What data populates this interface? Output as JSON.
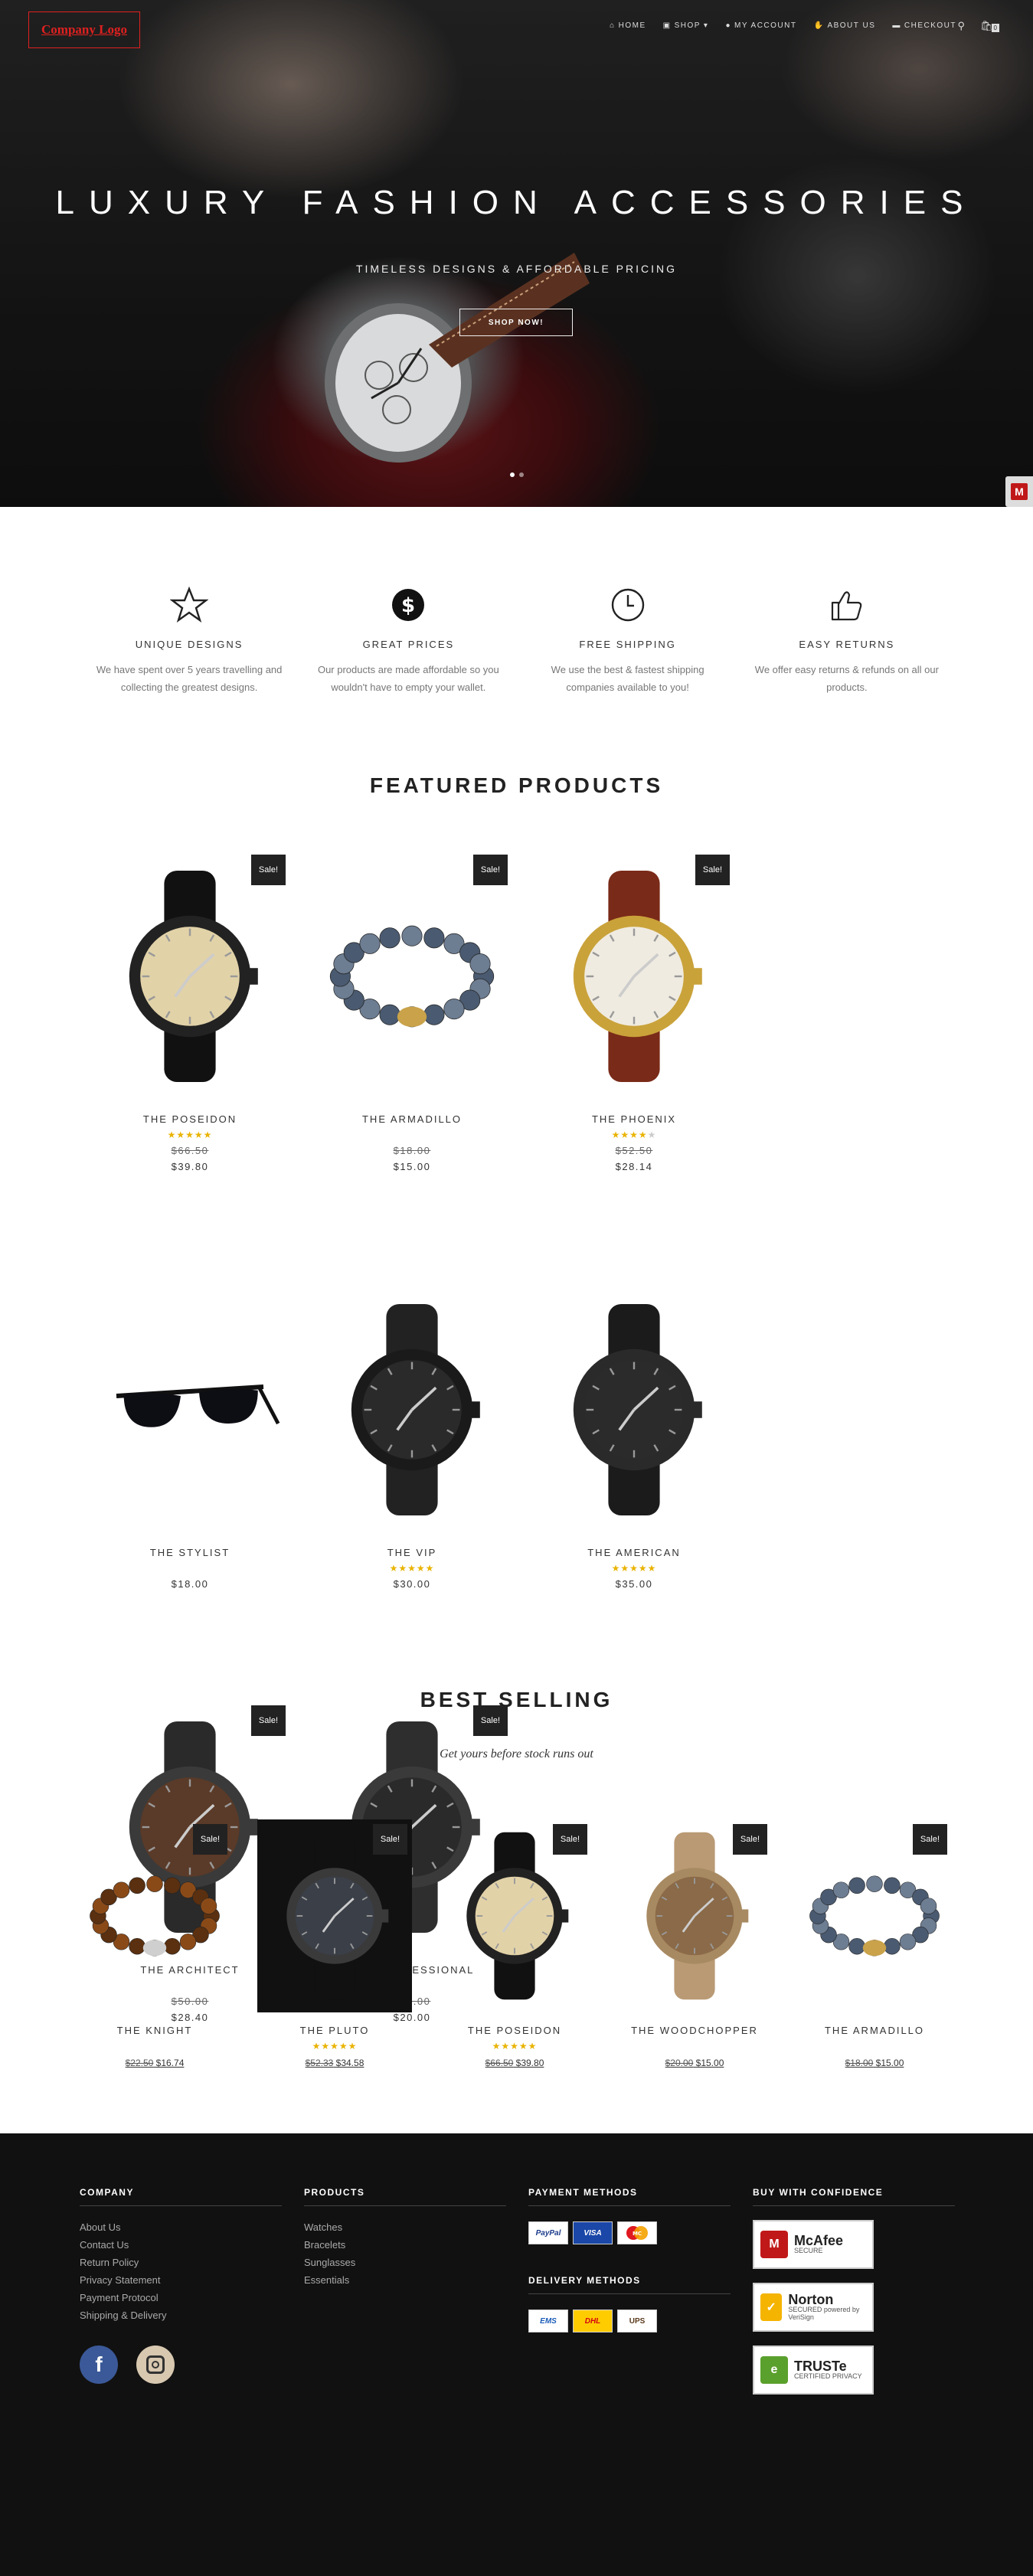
{
  "header": {
    "logo_text": "Company Logo",
    "nav": [
      {
        "label": "HOME",
        "icon": "home-icon"
      },
      {
        "label": "SHOP",
        "icon": "bag-icon"
      },
      {
        "label": "MY ACCOUNT",
        "icon": "user-icon"
      },
      {
        "label": "ABOUT US",
        "icon": "thumb-icon"
      },
      {
        "label": "CHECKOUT",
        "icon": "truck-icon"
      }
    ],
    "cart_count": "0"
  },
  "hero": {
    "title": "LUXURY FASHION ACCESSORIES",
    "subtitle": "TIMELESS DESIGNS & AFFORDABLE PRICING",
    "button": "SHOP NOW!"
  },
  "features": [
    {
      "title": "UNIQUE DESIGNS",
      "text": "We have spent over 5 years travelling and collecting the greatest designs.",
      "icon": "star-icon"
    },
    {
      "title": "GREAT PRICES",
      "text": "Our products are made affordable so you wouldn't have to empty your wallet.",
      "icon": "dollar-icon"
    },
    {
      "title": "FREE SHIPPING",
      "text": "We use the best & fastest shipping companies available to you!",
      "icon": "clock-icon"
    },
    {
      "title": "EASY RETURNS",
      "text": "We offer easy returns & refunds on all our products.",
      "icon": "thumbs-up-icon"
    }
  ],
  "featured": {
    "title": "FEATURED PRODUCTS",
    "sale_label": "Sale!",
    "products": [
      {
        "name": "THE POSEIDON",
        "old_price": "$66.50",
        "price": "$39.80",
        "rating": 5,
        "sale": true,
        "kind": "watch-gold-skeleton"
      },
      {
        "name": "THE ARMADILLO",
        "old_price": "$18.00",
        "price": "$15.00",
        "rating": 0,
        "sale": true,
        "kind": "bracelet-blue"
      },
      {
        "name": "THE PHOENIX",
        "old_price": "$52.50",
        "price": "$28.14",
        "rating": 4,
        "sale": true,
        "kind": "watch-gold-brown"
      },
      {
        "name": "THE STYLIST",
        "old_price": "",
        "price": "$18.00",
        "rating": 0,
        "sale": false,
        "kind": "sunglasses"
      },
      {
        "name": "THE VIP",
        "old_price": "",
        "price": "$30.00",
        "rating": 5,
        "sale": false,
        "kind": "watch-black-steel"
      },
      {
        "name": "THE AMERICAN",
        "old_price": "",
        "price": "$35.00",
        "rating": 5,
        "sale": false,
        "kind": "watch-black-chrono"
      },
      {
        "name": "THE ARCHITECT",
        "old_price": "$50.00",
        "price": "$28.40",
        "rating": 0,
        "sale": true,
        "kind": "watch-black-brown"
      },
      {
        "name": "THE PROFESSIONAL",
        "old_price": "$30.00",
        "price": "$20.00",
        "rating": 0,
        "sale": true,
        "kind": "watch-black-minimal"
      }
    ]
  },
  "best_selling": {
    "title": "BEST SELLING",
    "subtitle": "Get yours before stock runs out",
    "products": [
      {
        "name": "THE KNIGHT",
        "old_price": "$22.50",
        "price": "$16.74",
        "rating": 0,
        "kind": "bracelet-tiger"
      },
      {
        "name": "THE PLUTO",
        "old_price": "$52.33",
        "price": "$34.58",
        "rating": 5,
        "kind": "watch-pluto"
      },
      {
        "name": "THE POSEIDON",
        "old_price": "$66.50",
        "price": "$39.80",
        "rating": 5,
        "kind": "watch-gold-skeleton"
      },
      {
        "name": "THE WOODCHOPPER",
        "old_price": "$20.00",
        "price": "$15.00",
        "rating": 0,
        "kind": "watch-wood"
      },
      {
        "name": "THE ARMADILLO",
        "old_price": "$18.00",
        "price": "$15.00",
        "rating": 0,
        "kind": "bracelet-blue"
      }
    ]
  },
  "footer": {
    "company": {
      "title": "COMPANY",
      "links": [
        "About Us",
        "Contact Us",
        "Return Policy",
        "Privacy Statement",
        "Payment Protocol",
        "Shipping & Delivery"
      ]
    },
    "products": {
      "title": "PRODUCTS",
      "links": [
        "Watches",
        "Bracelets",
        "Sunglasses",
        "Essentials"
      ]
    },
    "payment": {
      "title": "PAYMENT METHODS",
      "methods": [
        "PayPal",
        "VISA",
        "MC"
      ]
    },
    "delivery": {
      "title": "DELIVERY METHODS",
      "methods": [
        "EMS",
        "DHL",
        "UPS"
      ]
    },
    "confidence": {
      "title": "BUY WITH CONFIDENCE",
      "badges": [
        {
          "name": "McAfee SECURE",
          "title": "McAfee",
          "sub": "SECURE",
          "color": "#c01818",
          "mark": "M"
        },
        {
          "name": "Norton SECURED",
          "title": "Norton",
          "sub": "SECURED powered by VeriSign",
          "color": "#f5b400",
          "mark": "✓"
        },
        {
          "name": "TRUSTe CERTIFIED PRIVACY",
          "title": "TRUSTe",
          "sub": "CERTIFIED PRIVACY",
          "color": "#5aa02c",
          "mark": "e"
        }
      ]
    },
    "social": [
      "facebook-icon",
      "instagram-icon"
    ]
  },
  "colors": {
    "accent_dark": "#222222",
    "star": "#e9b300",
    "footer_bg": "#111111"
  }
}
